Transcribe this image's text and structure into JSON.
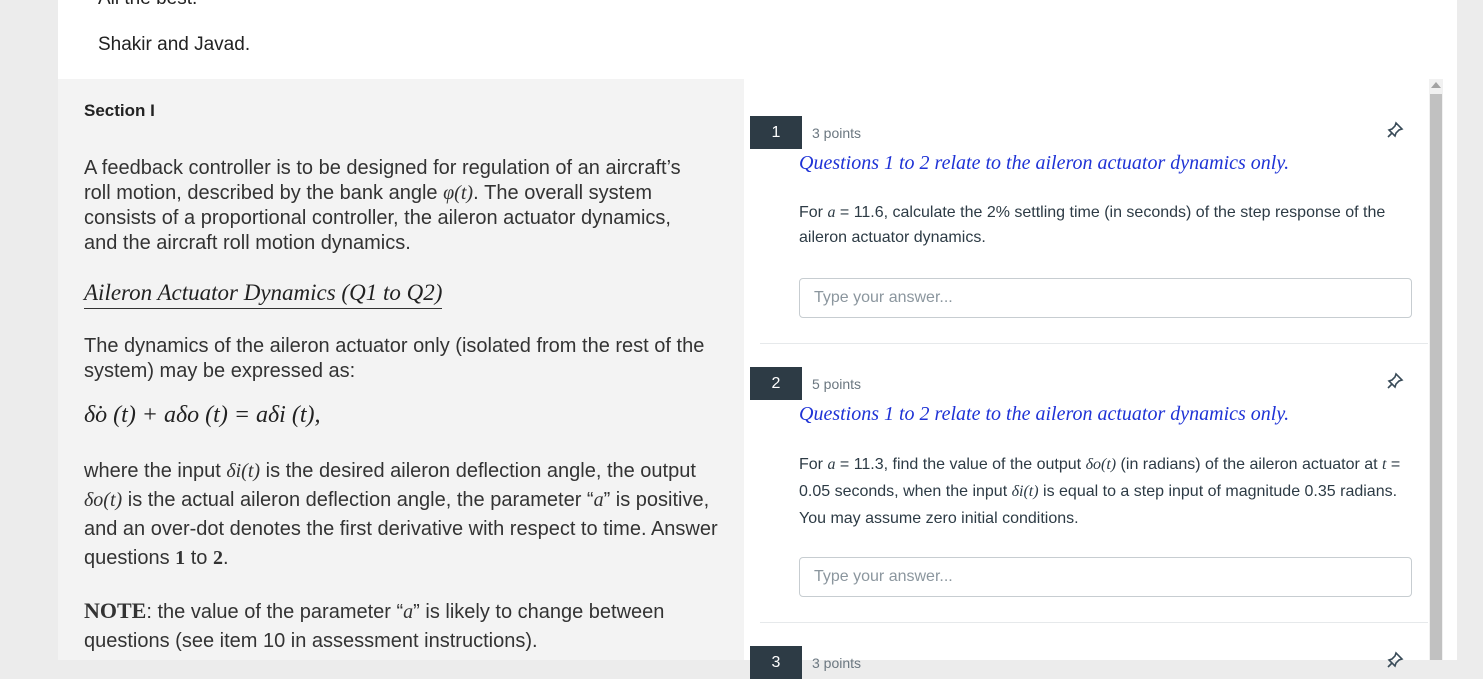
{
  "intro": {
    "line1": "All the best.",
    "line2": "Shakir and Javad."
  },
  "section": {
    "title": "Section I",
    "para1_a": "A feedback controller is to be designed for regulation of an aircraft’s roll motion, described by the bank angle ",
    "para1_math": "φ(t)",
    "para1_b": ". The overall system consists of a proportional controller, the aileron actuator dynamics, and the aircraft roll motion dynamics.",
    "subheading": "Aileron Actuator Dynamics (Q1 to Q2)",
    "para2": "The dynamics of the aileron actuator only (isolated from the rest of the system) may be expressed as:",
    "equation": "δ̇o (t) + aδo (t) = aδi (t),",
    "para3_a": "where the input ",
    "para3_m1": "δi(t)",
    "para3_b": " is the desired aileron deflection angle, the output ",
    "para3_m2": "δo(t)",
    "para3_c": " is the actual aileron deflection angle, the parameter “",
    "para3_m3": "a",
    "para3_d": "” is positive, and an over-dot denotes the first derivative with respect to time. Answer questions ",
    "para3_n1": "1",
    "para3_e": " to ",
    "para3_n2": "2",
    "para3_f": ".",
    "note_label": "NOTE",
    "note_a": ": the value of the parameter “",
    "note_m": "a",
    "note_b": "” is likely to change between questions (see item 10 in assessment instructions)."
  },
  "questions": [
    {
      "number": "1",
      "points": "3 points",
      "heading": "Questions 1 to 2 relate to the aileron actuator dynamics only.",
      "text_a": "For ",
      "text_m1": "a",
      "text_b": " = 11.6, calculate the 2% settling time (in seconds) of the step response of the aileron actuator dynamics.",
      "placeholder": "Type your answer..."
    },
    {
      "number": "2",
      "points": "5 points",
      "heading": "Questions 1 to 2 relate to the aileron actuator dynamics only.",
      "text_a": "For ",
      "text_m1": "a",
      "text_b": " = 11.3, find the value of the output ",
      "text_m2": "δo(t)",
      "text_c": " (in radians) of the aileron actuator at ",
      "text_m3": "t",
      "text_d": " = 0.05 seconds, when the input ",
      "text_m4": "δi(t)",
      "text_e": " is equal to a step input of magnitude 0.35 radians. You may assume zero initial conditions.",
      "placeholder": "Type your answer..."
    },
    {
      "number": "3",
      "points": "3 points"
    }
  ],
  "icons": {
    "pin": "pin-icon"
  },
  "colors": {
    "question_badge": "#2d3b45",
    "math_heading": "#1f33d6"
  }
}
